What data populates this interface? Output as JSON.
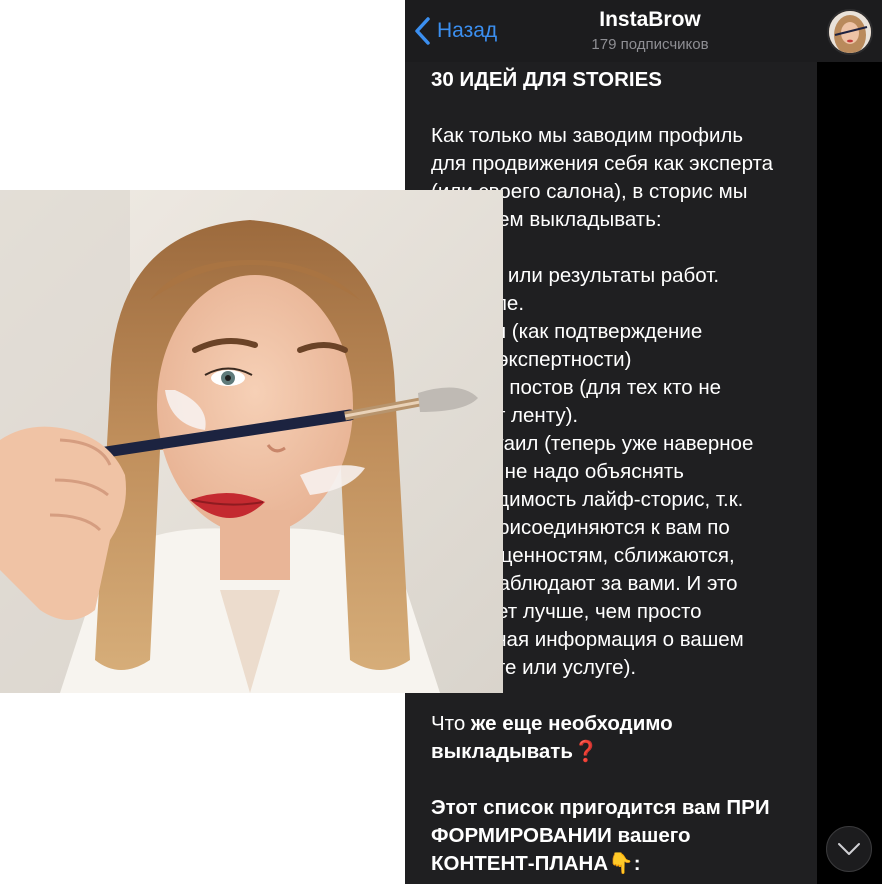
{
  "header": {
    "back_label": "Назад",
    "channel_title": "InstaBrow",
    "subscribers": "179 подписчиков"
  },
  "post": {
    "heading": "30 ИДЕЙ ДЛЯ STORIES",
    "intro": "Как только мы заводим профиль\nдля продвижения себя как эксперта\n(или своего салона), в сторис мы\nначинаем выкладывать:",
    "list": "Работы или результаты работ.\nДо/после.\nОтзывы (как подтверждение\nвашей экспертности)\nАнонсы постов (для тех кто не\nлистает ленту).\nЛайфстаил (теперь уже наверное\nникому не надо объяснять\nнеобходимость лайф-сторис, т.к.\nлюди присоединяются к вам по\nвашим ценностям, сближаются,\nкогда наблюдают за вами. И это\nработает лучше, чем просто\nзаученная информация о вашем\nпродукте или услуге).",
    "question_normal": "Что ",
    "question_bold": "же еще необходимо\nвыкладывать",
    "question_emoji": "❓",
    "plan": "Этот список пригодится вам ПРИ\nФОРМИРОВАНИИ вашего\nКОНТЕНТ-ПЛАНА",
    "plan_emoji": "👇",
    "plan_end": ":"
  },
  "colors": {
    "accent": "#3b8ff0",
    "background": "#000000",
    "bubble": "#1f1f21",
    "header": "#1c1c1e"
  },
  "icons": {
    "back": "chevron-left-icon",
    "scroll": "chevron-down-icon"
  }
}
